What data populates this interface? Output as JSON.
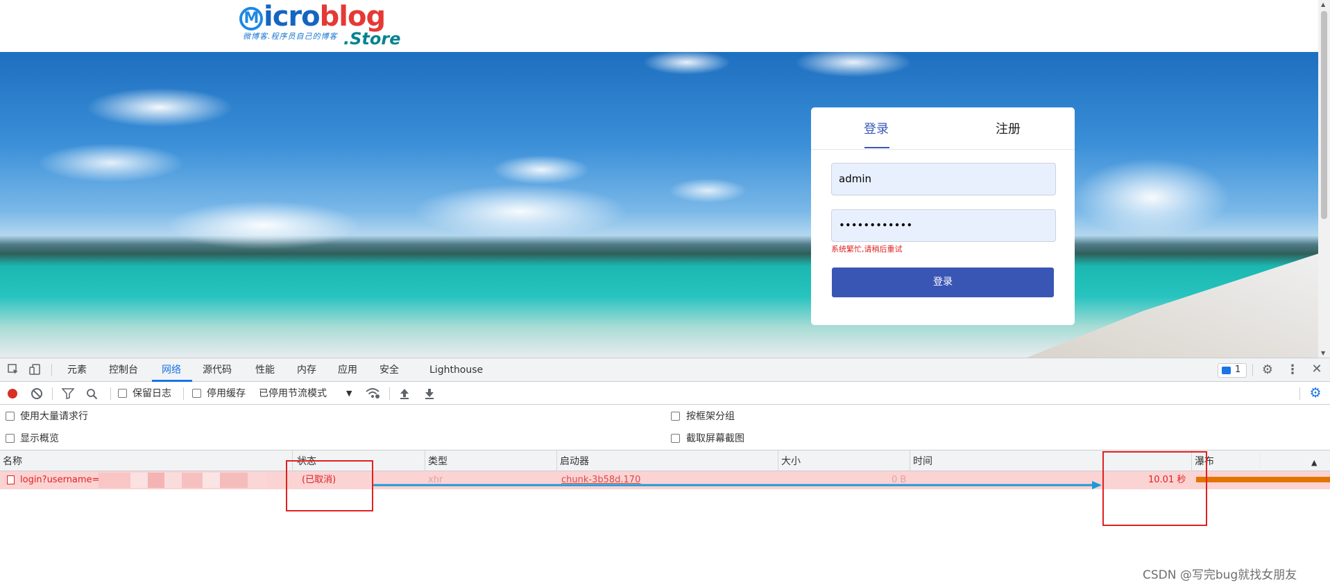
{
  "site": {
    "logo_text_main_blue": "icro",
    "logo_text_main_red": "blog",
    "logo_letter": "M",
    "logo_tagline": "微博客.程序员自己的博客",
    "logo_suffix": ".Store"
  },
  "login": {
    "tab_login": "登录",
    "tab_register": "注册",
    "username_value": "admin",
    "password_value": "••••••••••••",
    "error_message": "系统繁忙,请稍后重试",
    "submit_label": "登录"
  },
  "devtools": {
    "tabs": [
      "元素",
      "控制台",
      "网络",
      "源代码",
      "性能",
      "内存",
      "应用",
      "安全",
      "Lighthouse"
    ],
    "active_tab": "网络",
    "issues_count": "1",
    "toolbar": {
      "preserve_log": "保留日志",
      "disable_cache": "停用缓存",
      "throttling": "已停用节流模式"
    },
    "options": {
      "large_rows": "使用大量请求行",
      "group_by_frame": "按框架分组",
      "show_overview": "显示概览",
      "capture_screenshots": "截取屏幕截图"
    },
    "columns": [
      "名称",
      "状态",
      "类型",
      "启动器",
      "大小",
      "时间",
      "瀑布"
    ],
    "request": {
      "name": "login?username=",
      "status": "(已取消)",
      "type": "xhr",
      "initiator": "chunk-3b58d.170",
      "size": "0 B",
      "time": "10.01 秒"
    }
  },
  "watermark": "CSDN @写完bug就找女朋友",
  "colors": {
    "accent": "#3a56b5",
    "error": "#e02020",
    "devtools_blue": "#1a73e8",
    "waterfall": "#e37400",
    "annotation": "#1a9ad8"
  },
  "icons": [
    "inspect-icon",
    "device-icon",
    "issues-icon",
    "gear-icon",
    "more-icon",
    "close-icon",
    "record-icon",
    "clear-icon",
    "filter-icon",
    "search-icon",
    "wifi-icon",
    "upload-icon",
    "download-icon",
    "settings-icon",
    "sort-icon",
    "file-icon"
  ]
}
